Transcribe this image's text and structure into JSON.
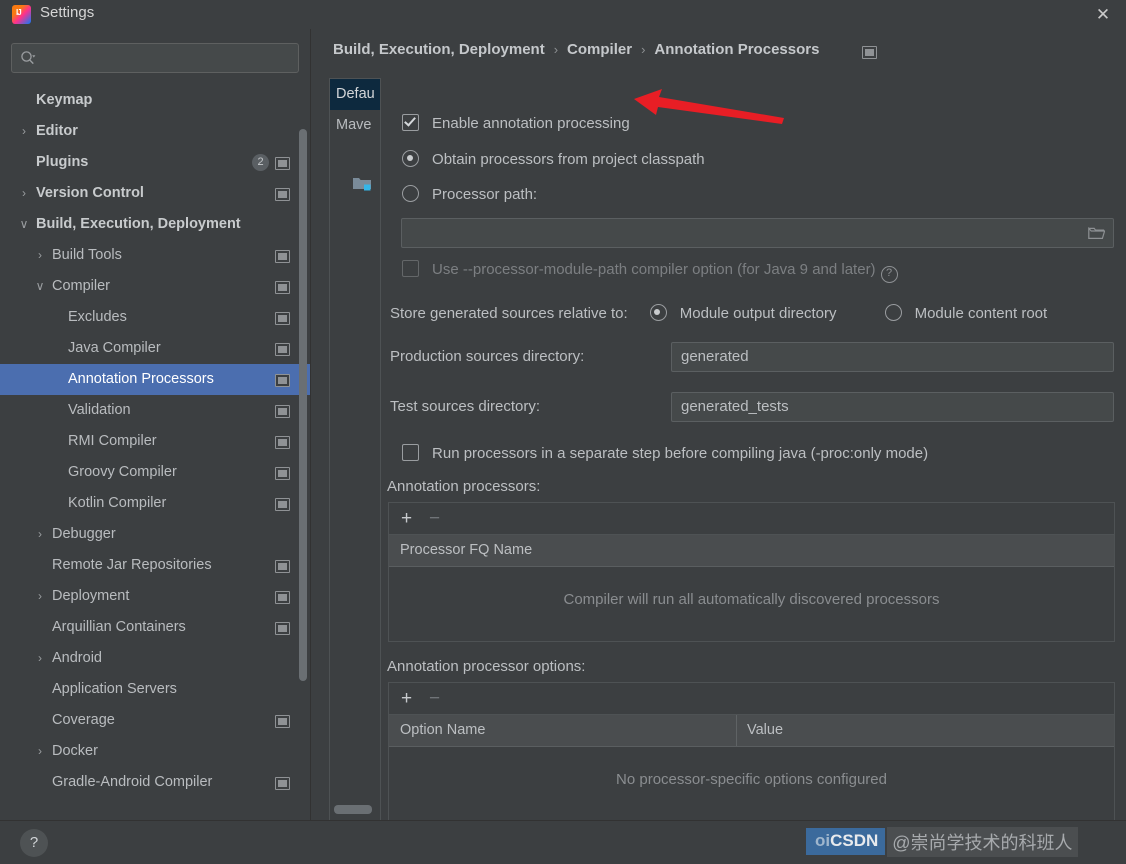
{
  "window": {
    "title": "Settings",
    "app_icon": "intellij-idea-icon",
    "close_label": "✕"
  },
  "sidebar": {
    "search": {
      "placeholder": "",
      "value": "",
      "icon": "search-icon"
    },
    "items": [
      {
        "label": "Keymap",
        "indent": 0,
        "chevron": "",
        "bold": true,
        "cfg": false,
        "badge": null,
        "selected": false
      },
      {
        "label": "Editor",
        "indent": 0,
        "chevron": "›",
        "bold": true,
        "cfg": false,
        "badge": null,
        "selected": false
      },
      {
        "label": "Plugins",
        "indent": 0,
        "chevron": "",
        "bold": true,
        "cfg": true,
        "badge": "2",
        "selected": false
      },
      {
        "label": "Version Control",
        "indent": 0,
        "chevron": "›",
        "bold": true,
        "cfg": true,
        "badge": null,
        "selected": false
      },
      {
        "label": "Build, Execution, Deployment",
        "indent": 0,
        "chevron": "∨",
        "bold": true,
        "cfg": false,
        "badge": null,
        "selected": false
      },
      {
        "label": "Build Tools",
        "indent": 1,
        "chevron": "›",
        "bold": false,
        "cfg": true,
        "badge": null,
        "selected": false
      },
      {
        "label": "Compiler",
        "indent": 1,
        "chevron": "∨",
        "bold": false,
        "cfg": true,
        "badge": null,
        "selected": false
      },
      {
        "label": "Excludes",
        "indent": 2,
        "chevron": "",
        "bold": false,
        "cfg": true,
        "badge": null,
        "selected": false
      },
      {
        "label": "Java Compiler",
        "indent": 2,
        "chevron": "",
        "bold": false,
        "cfg": true,
        "badge": null,
        "selected": false
      },
      {
        "label": "Annotation Processors",
        "indent": 2,
        "chevron": "",
        "bold": false,
        "cfg": true,
        "badge": null,
        "selected": true
      },
      {
        "label": "Validation",
        "indent": 2,
        "chevron": "",
        "bold": false,
        "cfg": true,
        "badge": null,
        "selected": false
      },
      {
        "label": "RMI Compiler",
        "indent": 2,
        "chevron": "",
        "bold": false,
        "cfg": true,
        "badge": null,
        "selected": false
      },
      {
        "label": "Groovy Compiler",
        "indent": 2,
        "chevron": "",
        "bold": false,
        "cfg": true,
        "badge": null,
        "selected": false
      },
      {
        "label": "Kotlin Compiler",
        "indent": 2,
        "chevron": "",
        "bold": false,
        "cfg": true,
        "badge": null,
        "selected": false
      },
      {
        "label": "Debugger",
        "indent": 1,
        "chevron": "›",
        "bold": false,
        "cfg": false,
        "badge": null,
        "selected": false
      },
      {
        "label": "Remote Jar Repositories",
        "indent": 1,
        "chevron": "",
        "bold": false,
        "cfg": true,
        "badge": null,
        "selected": false
      },
      {
        "label": "Deployment",
        "indent": 1,
        "chevron": "›",
        "bold": false,
        "cfg": true,
        "badge": null,
        "selected": false
      },
      {
        "label": "Arquillian Containers",
        "indent": 1,
        "chevron": "",
        "bold": false,
        "cfg": true,
        "badge": null,
        "selected": false
      },
      {
        "label": "Android",
        "indent": 1,
        "chevron": "›",
        "bold": false,
        "cfg": false,
        "badge": null,
        "selected": false
      },
      {
        "label": "Application Servers",
        "indent": 1,
        "chevron": "",
        "bold": false,
        "cfg": false,
        "badge": null,
        "selected": false
      },
      {
        "label": "Coverage",
        "indent": 1,
        "chevron": "",
        "bold": false,
        "cfg": true,
        "badge": null,
        "selected": false
      },
      {
        "label": "Docker",
        "indent": 1,
        "chevron": "›",
        "bold": false,
        "cfg": false,
        "badge": null,
        "selected": false
      },
      {
        "label": "Gradle-Android Compiler",
        "indent": 1,
        "chevron": "",
        "bold": false,
        "cfg": true,
        "badge": null,
        "selected": false
      }
    ]
  },
  "breadcrumb": {
    "parts": [
      "Build, Execution, Deployment",
      "Compiler",
      "Annotation Processors"
    ],
    "separator": "›",
    "config_icon": "settings-icon"
  },
  "modules": {
    "expand_label": "»",
    "items": [
      {
        "label": "Defau",
        "selected": true
      },
      {
        "label": "Mave",
        "selected": false
      }
    ],
    "folder_icon": "module-folder-icon"
  },
  "form": {
    "enable_annotation_processing": {
      "label": "Enable annotation processing",
      "checked": true
    },
    "processor_source": {
      "options": [
        {
          "label": "Obtain processors from project classpath",
          "selected": true
        },
        {
          "label": "Processor path:",
          "selected": false
        }
      ]
    },
    "processor_path": {
      "value": "",
      "placeholder": "",
      "browse_icon": "folder-browse-icon"
    },
    "use_module_path": {
      "label": "Use --processor-module-path compiler option (for Java 9 and later)",
      "checked": false,
      "disabled": true,
      "help_icon": "?"
    },
    "store_relative_to": {
      "label": "Store generated sources relative to:",
      "options": [
        {
          "label": "Module output directory",
          "selected": true
        },
        {
          "label": "Module content root",
          "selected": false
        }
      ]
    },
    "production_sources": {
      "label": "Production sources directory:",
      "value": "generated"
    },
    "test_sources": {
      "label": "Test sources directory:",
      "value": "generated_tests"
    },
    "run_separate_step": {
      "label": "Run processors in a separate step before compiling java (-proc:only mode)",
      "checked": false
    },
    "processors_table": {
      "caption": "Annotation processors:",
      "add_label": "+",
      "remove_label": "−",
      "columns": [
        "Processor FQ Name"
      ],
      "rows": [],
      "empty_text": "Compiler will run all automatically discovered processors"
    },
    "options_table": {
      "caption": "Annotation processor options:",
      "add_label": "+",
      "remove_label": "−",
      "columns": [
        "Option Name",
        "Value"
      ],
      "rows": [],
      "empty_text": "No processor-specific options configured"
    }
  },
  "footer": {
    "help_label": "?"
  },
  "watermark": {
    "brand_prefix": "oi",
    "brand": "CSDN",
    "user": "@崇尚学技术的科班人"
  },
  "annotation": {
    "arrow_color": "#e81e25",
    "points_to": "Enable annotation processing"
  }
}
